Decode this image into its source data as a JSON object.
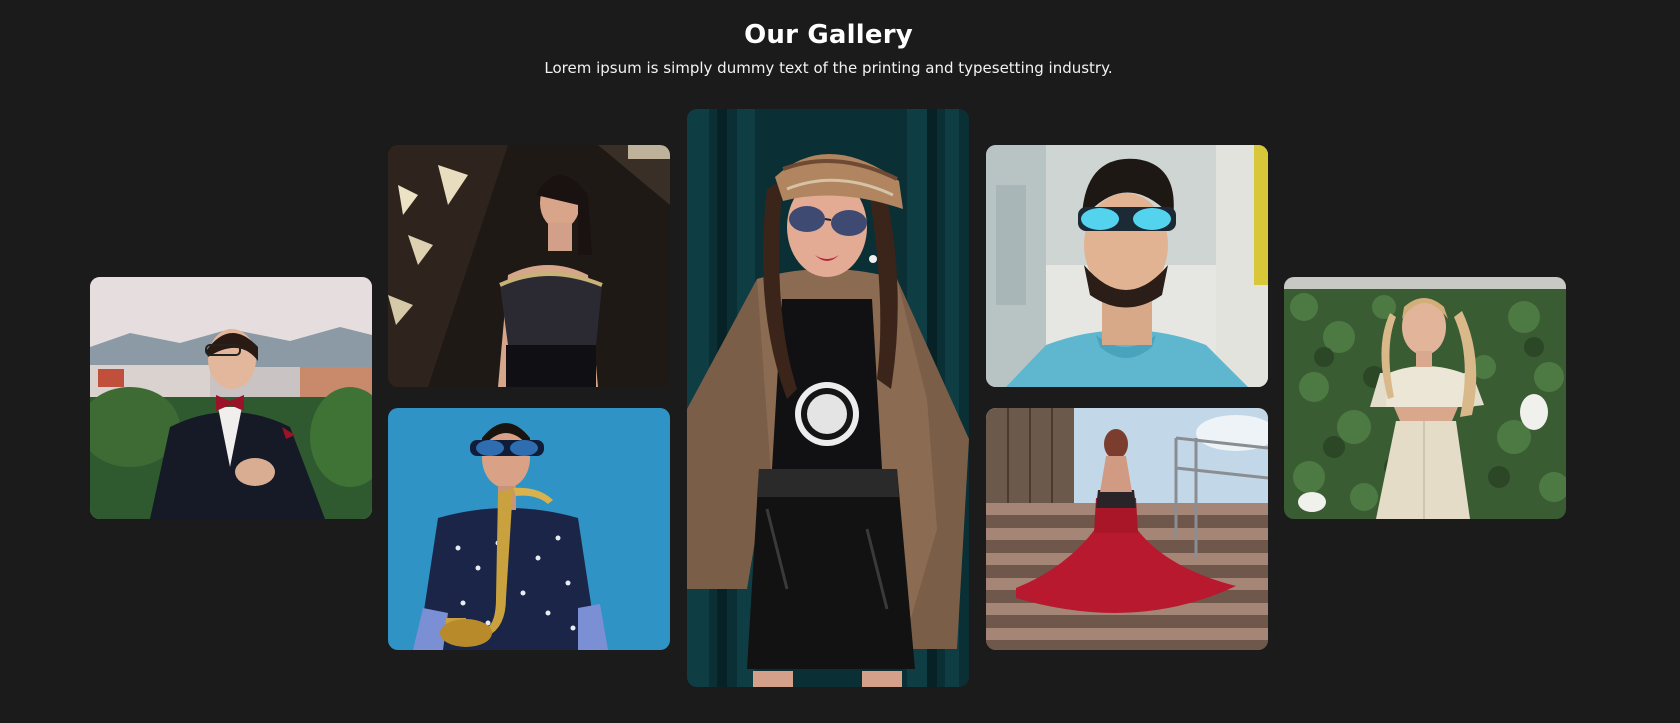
{
  "gallery": {
    "title": "Our Gallery",
    "subtitle": "Lorem ipsum is simply dummy text of the printing and typesetting industry."
  },
  "photos": [
    {
      "id": "tuxedo-man",
      "subject": "man in tuxedo with red bow tie",
      "accent": "#1a2230"
    },
    {
      "id": "woman-corset",
      "subject": "woman in black corset top",
      "accent": "#2a231e"
    },
    {
      "id": "saxophone-man",
      "subject": "man with saxophone on blue wall",
      "accent": "#2f8fc0"
    },
    {
      "id": "woman-plaid-jacket",
      "subject": "woman in plaid jacket and beret",
      "accent": "#0c3b41"
    },
    {
      "id": "man-sunglasses",
      "subject": "man in blue sunglasses looking up",
      "accent": "#5fb6c8"
    },
    {
      "id": "woman-red-dress",
      "subject": "woman in red gown on stairs",
      "accent": "#b51e33"
    },
    {
      "id": "woman-white-outfit",
      "subject": "woman in white outfit by ivy wall",
      "accent": "#3c5d35"
    }
  ]
}
